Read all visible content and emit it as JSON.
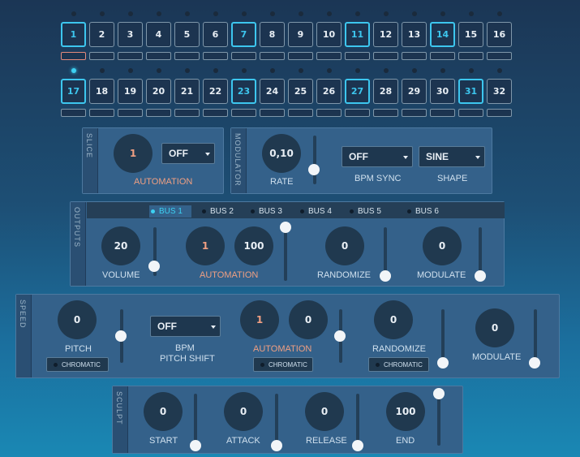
{
  "steps_row1": [
    {
      "label": "1",
      "selected": true
    },
    {
      "label": "2",
      "selected": false
    },
    {
      "label": "3",
      "selected": false
    },
    {
      "label": "4",
      "selected": false
    },
    {
      "label": "5",
      "selected": false
    },
    {
      "label": "6",
      "selected": false
    },
    {
      "label": "7",
      "selected": true
    },
    {
      "label": "8",
      "selected": false
    },
    {
      "label": "9",
      "selected": false
    },
    {
      "label": "10",
      "selected": false
    },
    {
      "label": "11",
      "selected": true
    },
    {
      "label": "12",
      "selected": false
    },
    {
      "label": "13",
      "selected": false
    },
    {
      "label": "14",
      "selected": true
    },
    {
      "label": "15",
      "selected": false
    },
    {
      "label": "16",
      "selected": false
    }
  ],
  "steps_row2": [
    {
      "label": "17",
      "selected": true
    },
    {
      "label": "18",
      "selected": false
    },
    {
      "label": "19",
      "selected": false
    },
    {
      "label": "20",
      "selected": false
    },
    {
      "label": "21",
      "selected": false
    },
    {
      "label": "22",
      "selected": false
    },
    {
      "label": "23",
      "selected": true
    },
    {
      "label": "24",
      "selected": false
    },
    {
      "label": "25",
      "selected": false
    },
    {
      "label": "26",
      "selected": false
    },
    {
      "label": "27",
      "selected": true
    },
    {
      "label": "28",
      "selected": false
    },
    {
      "label": "29",
      "selected": false
    },
    {
      "label": "30",
      "selected": false
    },
    {
      "label": "31",
      "selected": true
    },
    {
      "label": "32",
      "selected": false
    }
  ],
  "active_step": "17",
  "current_step": "1",
  "colors": {
    "accent": "#3dc6ee",
    "orange": "#ef9f82",
    "panel": "#34618a",
    "knob": "#20394f"
  },
  "slice": {
    "section": "SLICE",
    "knob_value": "1",
    "select_value": "OFF",
    "automation_label": "AUTOMATION"
  },
  "modulator": {
    "section": "MODULATOR",
    "rate_value": "0,10",
    "rate_label": "RATE",
    "rate_slider": 0.3,
    "bpm_sync_value": "OFF",
    "bpm_sync_label": "BPM SYNC",
    "shape_value": "SINE",
    "shape_label": "SHAPE"
  },
  "outputs": {
    "section": "OUTPUTS",
    "tabs": [
      "BUS 1",
      "BUS 2",
      "BUS 3",
      "BUS 4",
      "BUS 5",
      "BUS 6"
    ],
    "active_tab": "BUS 1",
    "volume_value": "20",
    "volume_label": "VOLUME",
    "volume_slider": 0.2,
    "automation_value1": "1",
    "automation_value2": "100",
    "automation_label": "AUTOMATION",
    "automation_slider": 1.0,
    "randomize_value": "0",
    "randomize_label": "RANDOMIZE",
    "randomize_slider": 0,
    "modulate_value": "0",
    "modulate_label": "MODULATE",
    "modulate_slider": 0
  },
  "speed": {
    "section": "SPEED",
    "pitch_value": "0",
    "pitch_label": "PITCH",
    "pitch_slider": 0.5,
    "chromatic_label": "CHROMATIC",
    "bpm_value": "OFF",
    "bpm_label": "BPM",
    "pitch_shift_label": "PITCH SHIFT",
    "automation_value1": "1",
    "automation_value2": "0",
    "automation_label": "AUTOMATION",
    "automation_slider": 0.5,
    "randomize_value": "0",
    "randomize_label": "RANDOMIZE",
    "randomize_slider": 0,
    "modulate_value": "0",
    "modulate_label": "MODULATE",
    "modulate_slider": 0
  },
  "sculpt": {
    "section": "SCULPT",
    "start_value": "0",
    "start_label": "START",
    "start_slider": 0,
    "attack_value": "0",
    "attack_label": "ATTACK",
    "attack_slider": 0,
    "release_value": "0",
    "release_label": "RELEASE",
    "release_slider": 0,
    "end_value": "100",
    "end_label": "END",
    "end_slider": 1.0
  }
}
